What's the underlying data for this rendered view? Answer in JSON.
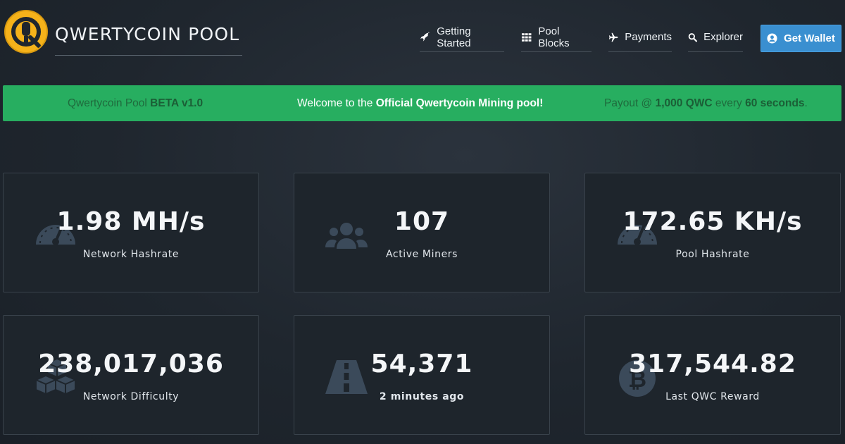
{
  "brand": {
    "title": "QWERTYCOIN POOL",
    "logo_icon": "qwertycoin-logo-icon",
    "accent": "#f5b21a"
  },
  "nav": {
    "items": [
      {
        "label": "Getting Started",
        "icon": "rocket-icon"
      },
      {
        "label": "Pool Blocks",
        "icon": "grid-icon"
      },
      {
        "label": "Payments",
        "icon": "plane-icon"
      },
      {
        "label": "Explorer",
        "icon": "search-icon"
      }
    ],
    "wallet_button": {
      "label": "Get Wallet",
      "icon": "user-circle-icon",
      "color": "#3a8fd0"
    }
  },
  "banner": {
    "color": "#27ae60",
    "left_prefix": "Qwertycoin Pool ",
    "left_strong": "BETA v1.0",
    "center_prefix": "Welcome to the ",
    "center_strong": "Official Qwertycoin Mining pool!",
    "right_prefix": "Payout @ ",
    "right_amount": "1,000 QWC",
    "right_mid": " every ",
    "right_interval": "60 seconds",
    "right_suffix": "."
  },
  "stats": [
    {
      "value": "1.98 MH/s",
      "label": "Network Hashrate",
      "icon": "tachometer-icon"
    },
    {
      "value": "107",
      "label": "Active Miners",
      "icon": "users-icon"
    },
    {
      "value": "172.65 KH/s",
      "label": "Pool Hashrate",
      "icon": "tachometer-icon"
    },
    {
      "value": "238,017,036",
      "label": "Network Difficulty",
      "icon": "cubes-icon"
    },
    {
      "value": "54,371",
      "label": "2 minutes ago",
      "icon": "road-icon"
    },
    {
      "value": "317,544.82",
      "label": "Last QWC Reward",
      "icon": "bitcoin-icon"
    }
  ]
}
